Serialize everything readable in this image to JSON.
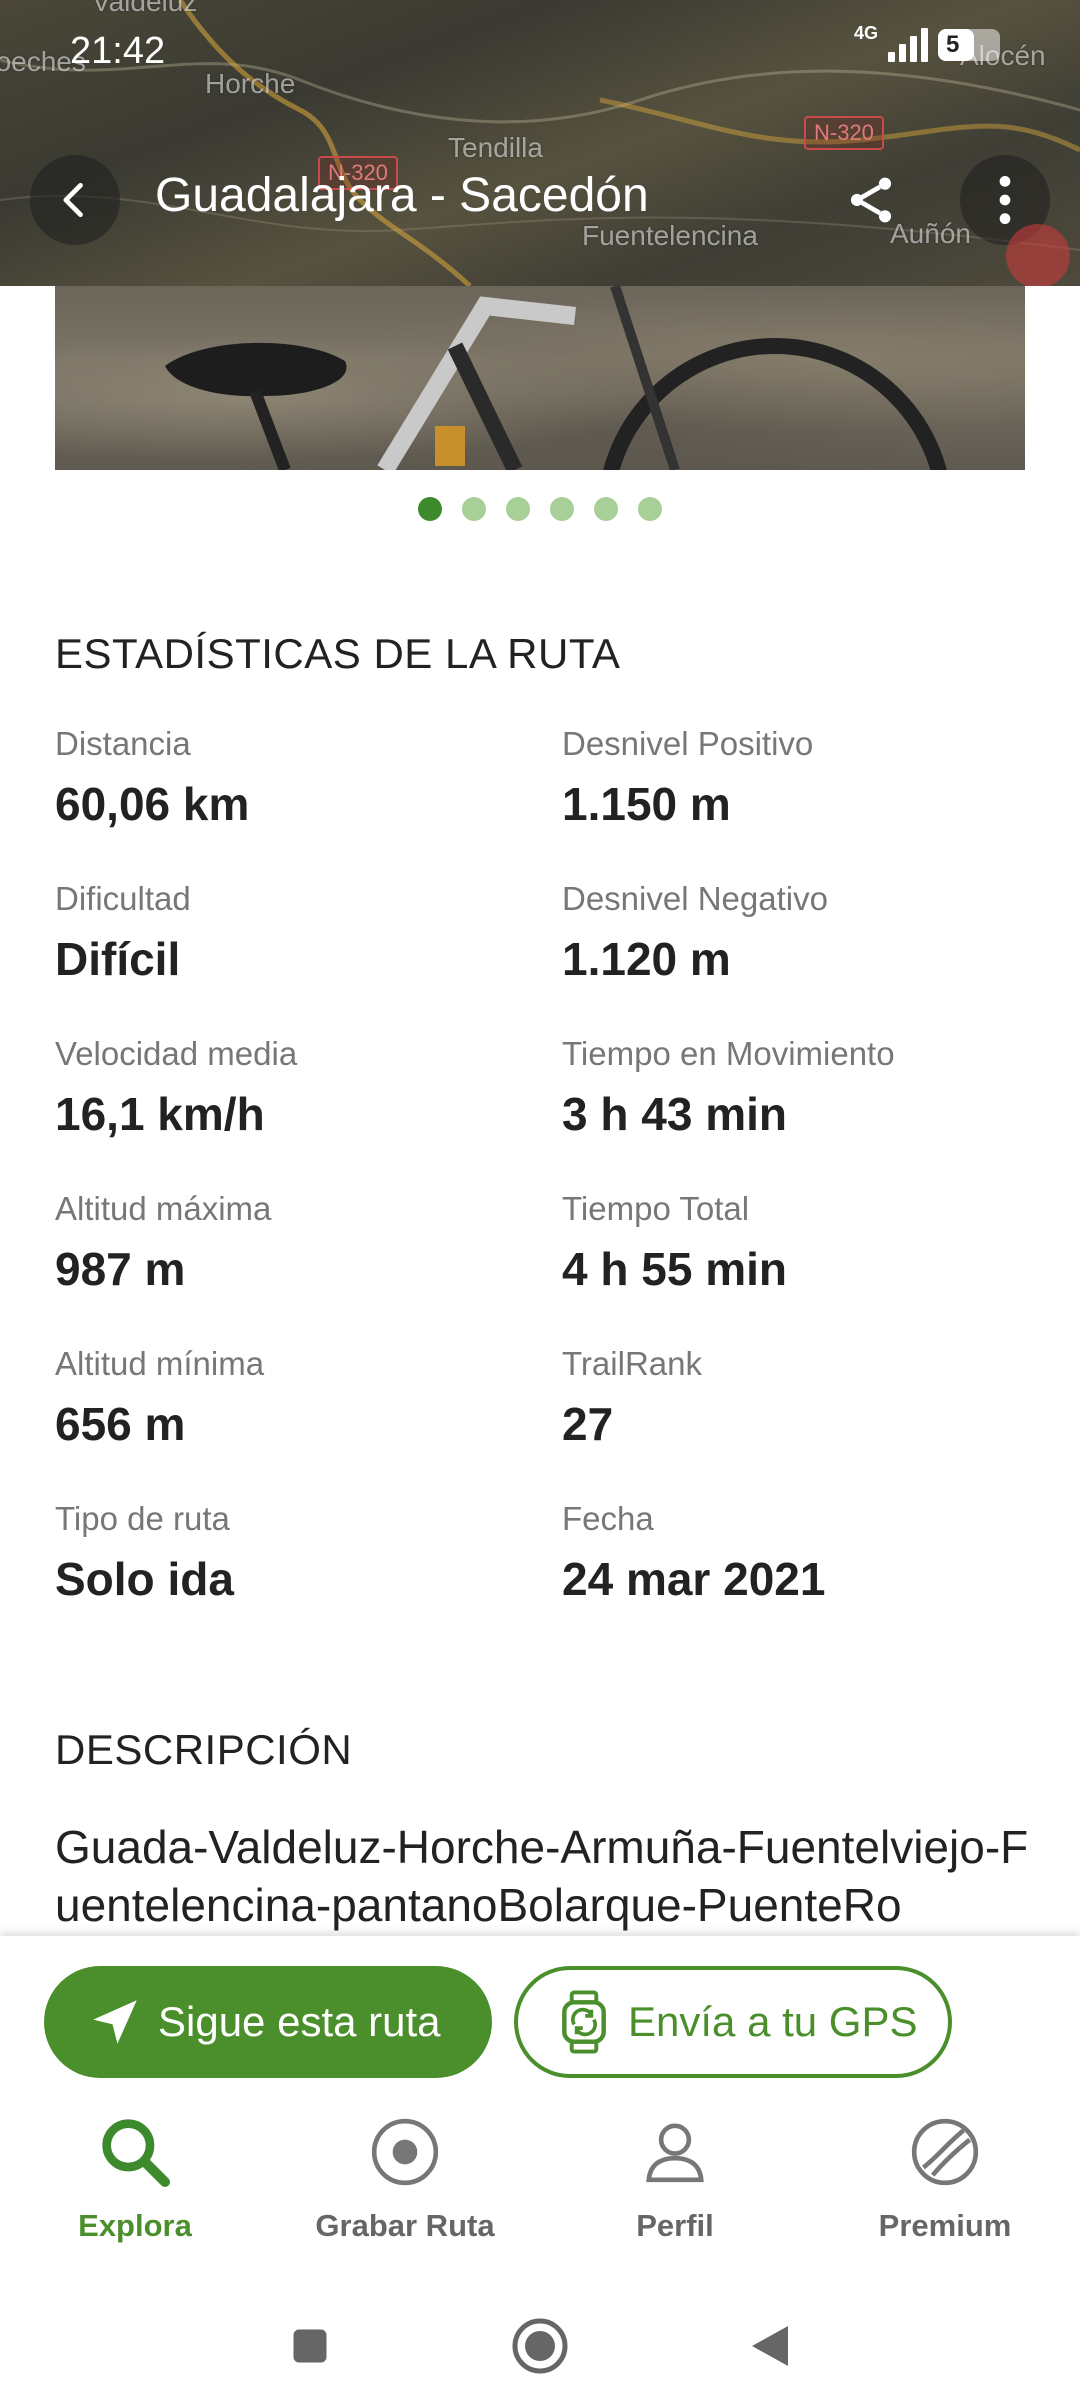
{
  "status_bar": {
    "time": "21:42",
    "network": "4G",
    "battery": "5"
  },
  "map": {
    "labels": [
      "Valdeluz",
      "Horche",
      "Tendilla",
      "Fuentelencina",
      "Auñón",
      "Loeches",
      "Alocén"
    ],
    "roads": [
      "N-320",
      "N-320"
    ]
  },
  "header": {
    "title": "Guadalajara - Sacedón",
    "back_icon": "arrow-left-icon",
    "share_icon": "share-icon",
    "more_icon": "more-vertical-icon"
  },
  "gallery": {
    "photo_count": 6,
    "active_index": 0
  },
  "stats": {
    "section_title": "ESTADÍSTICAS DE LA RUTA",
    "items": [
      {
        "label": "Distancia",
        "value": "60,06 km"
      },
      {
        "label": "Desnivel Positivo",
        "value": "1.150 m"
      },
      {
        "label": "Dificultad",
        "value": "Difícil"
      },
      {
        "label": "Desnivel Negativo",
        "value": "1.120 m"
      },
      {
        "label": "Velocidad media",
        "value": "16,1 km/h"
      },
      {
        "label": "Tiempo en Movimiento",
        "value": "3 h 43 min"
      },
      {
        "label": "Altitud máxima",
        "value": "987 m"
      },
      {
        "label": "Tiempo Total",
        "value": "4 h 55 min"
      },
      {
        "label": "Altitud mínima",
        "value": "656 m"
      },
      {
        "label": "TrailRank",
        "value": "27"
      },
      {
        "label": "Tipo de ruta",
        "value": "Solo ida"
      },
      {
        "label": "Fecha",
        "value": "24 mar 2021"
      }
    ]
  },
  "description": {
    "section_title": "DESCRIPCIÓN",
    "text": "Guada-Valdeluz-Horche-Armuña-Fuentelviejo-Fuentelencina-pantanoBolarque-PuenteRo"
  },
  "actions": {
    "follow_label": "Sigue esta ruta",
    "follow_icon": "navigation-arrow-icon",
    "gps_label": "Envía a tu GPS",
    "gps_icon": "watch-sync-icon"
  },
  "bottom_nav": {
    "items": [
      {
        "label": "Explora",
        "icon": "search-icon",
        "active": true
      },
      {
        "label": "Grabar Ruta",
        "icon": "record-icon",
        "active": false
      },
      {
        "label": "Perfil",
        "icon": "person-icon",
        "active": false
      },
      {
        "label": "Premium",
        "icon": "premium-icon",
        "active": false
      }
    ]
  },
  "colors": {
    "accent": "#4a8f2c",
    "dot_active": "#3d8a2c",
    "dot_inactive": "#a9cf98",
    "label_gray": "#777777"
  }
}
